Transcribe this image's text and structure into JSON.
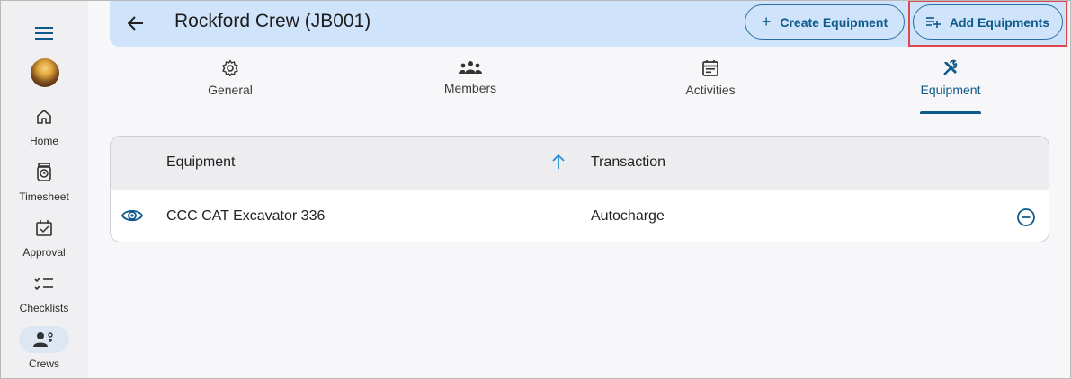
{
  "sidebar": {
    "items": [
      {
        "label": "Home",
        "icon": "home-icon"
      },
      {
        "label": "Timesheet",
        "icon": "timesheet-icon"
      },
      {
        "label": "Approval",
        "icon": "approval-icon"
      },
      {
        "label": "Checklists",
        "icon": "checklist-icon"
      },
      {
        "label": "Crews",
        "icon": "crews-icon",
        "active": true
      }
    ]
  },
  "header": {
    "title": "Rockford Crew (JB001)",
    "create_button": "Create Equipment",
    "add_button": "Add Equipments"
  },
  "tabs": [
    {
      "label": "General",
      "icon": "gear-icon"
    },
    {
      "label": "Members",
      "icon": "members-icon"
    },
    {
      "label": "Activities",
      "icon": "calendar-icon"
    },
    {
      "label": "Equipment",
      "icon": "tools-icon",
      "active": true
    }
  ],
  "table": {
    "columns": [
      "Equipment",
      "Transaction"
    ],
    "rows": [
      {
        "equipment": "CCC CAT Excavator 336",
        "transaction": "Autocharge"
      }
    ]
  },
  "colors": {
    "accent": "#0e5a8a",
    "header_bg": "#cfe4fb",
    "highlight": "#e0474c"
  }
}
